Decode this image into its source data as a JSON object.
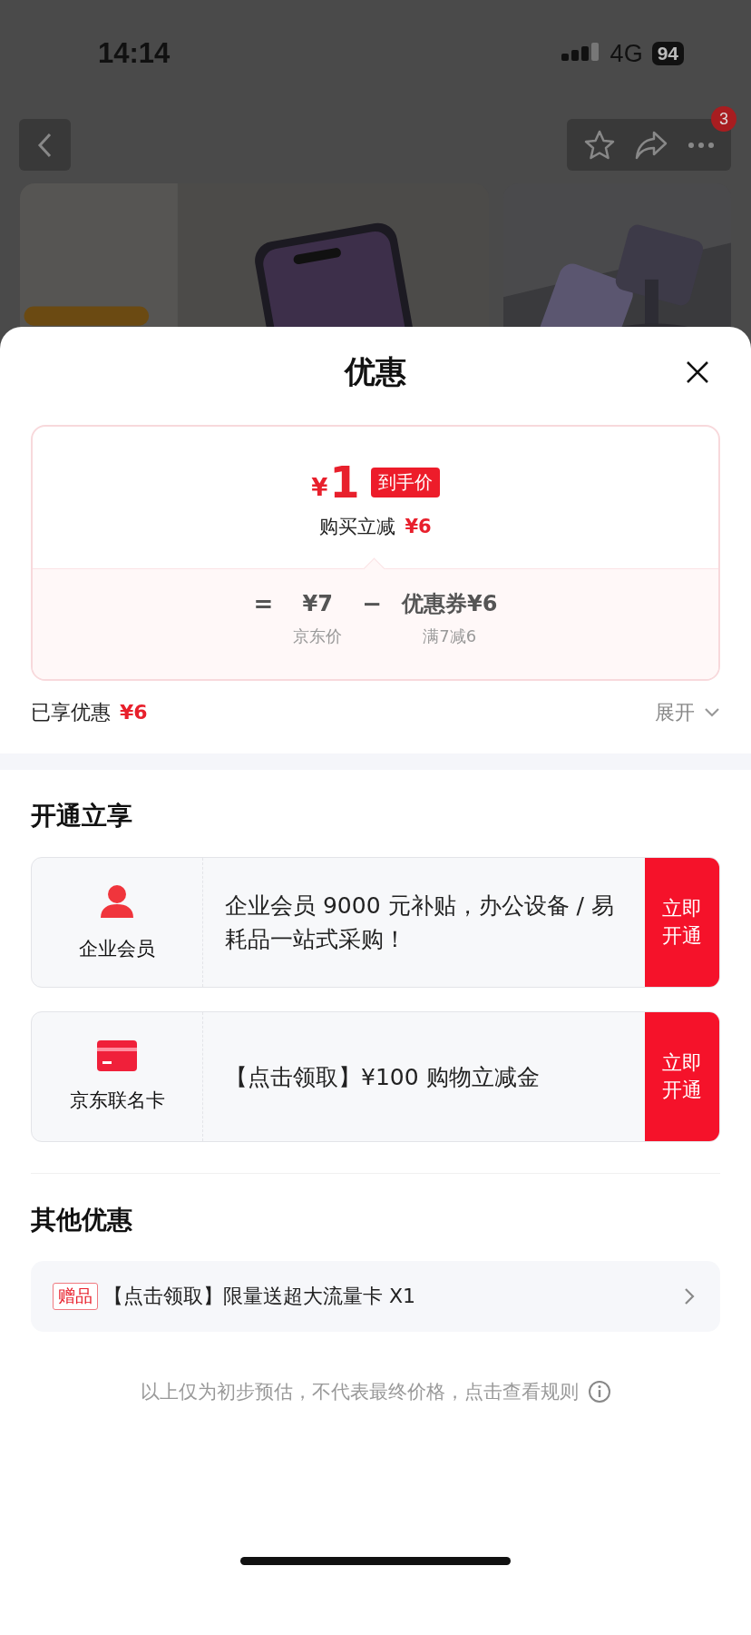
{
  "status_bar": {
    "time": "14:14",
    "network": "4G",
    "battery": "94"
  },
  "nav": {
    "badge": "3"
  },
  "sheet": {
    "title": "优惠",
    "price_card": {
      "currency": "¥",
      "price": "1",
      "price_tag": "到手价",
      "saving_label": "购买立减",
      "saving_amount": "¥6",
      "equals": "=",
      "base_price": "¥7",
      "base_label": "京东价",
      "minus": "−",
      "coupon": "优惠券¥6",
      "coupon_rule": "满7减6"
    },
    "summary": {
      "label": "已享优惠",
      "amount": "¥6",
      "toggle": "展开",
      "expanded": false
    },
    "open_section": {
      "title": "开通立享",
      "offers": [
        {
          "kind": "member",
          "name": "企业会员",
          "text": "企业会员 9000 元补贴，办公设备 / 易耗品一站式采购！",
          "button": "立即开通"
        },
        {
          "kind": "card",
          "name": "京东联名卡",
          "text": "【点击领取】¥100 购物立减金",
          "button": "立即开通"
        }
      ]
    },
    "other_section": {
      "title": "其他优惠",
      "items": [
        {
          "tag": "赠品",
          "text": "【点击领取】限量送超大流量卡 X1"
        }
      ]
    },
    "footnote": "以上仅为初步预估，不代表最终价格，点击查看规则"
  }
}
